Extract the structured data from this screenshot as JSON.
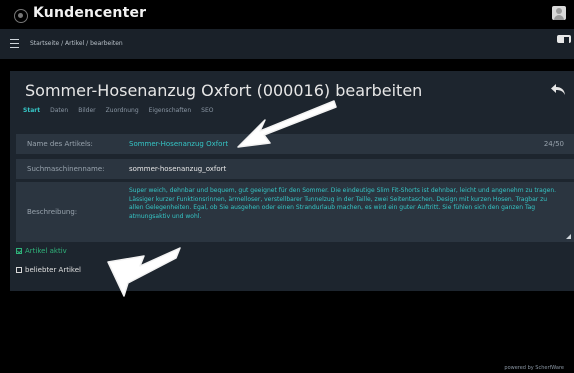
{
  "app": {
    "title": "Kundencenter",
    "logo_icon": "app-logo-icon",
    "user_icon": "user-avatar-icon"
  },
  "nav": {
    "menu_icon": "hamburger-menu-icon",
    "breadcrumb": "Startseite / Artikel / bearbeiten"
  },
  "page": {
    "title": "Sommer-Hosenanzug Oxfort (000016) bearbeiten",
    "back_icon": "back-arrow-icon"
  },
  "tabs": [
    {
      "label": "Start",
      "active": true
    },
    {
      "label": "Daten",
      "active": false
    },
    {
      "label": "Bilder",
      "active": false
    },
    {
      "label": "Zuordnung",
      "active": false
    },
    {
      "label": "Eigenschaften",
      "active": false
    },
    {
      "label": "SEO",
      "active": false
    }
  ],
  "form": {
    "name_label": "Name des Artikels:",
    "name_value": "Sommer-Hosenanzug Oxfort",
    "name_counter": "24/50",
    "slug_label": "Suchmaschinenname:",
    "slug_value": "sommer-hosenanzug_oxfort",
    "desc_label": "Beschreibung:",
    "desc_value": "Super weich, dehnbar und bequem, gut geeignet für den Sommer. Die eindeutige Slim Fit-Shorts ist dehnbar, leicht und angenehm zu tragen. Lässiger kurzer Funktionsrinnen, ärmelloser, verstellbarer Tunnelzug in der Taille, zwei Seitentaschen. Design mit kurzen Hosen. Tragbar zu allen Gelegenheiten. Egal, ob Sie ausgehen oder einen Strandurlaub machen, es wird ein guter Auftritt. Sie fühlen sich den ganzen Tag atmungsaktiv und wohl."
  },
  "checkboxes": [
    {
      "label": "Artikel aktiv",
      "checked": true
    },
    {
      "label": "beliebter Artikel",
      "checked": false
    }
  ],
  "footer": "powered by ScherfWare",
  "colors": {
    "accent": "#35c6c6",
    "panel": "#1d252e",
    "field": "#2b3540",
    "check": "#2fb37a"
  }
}
